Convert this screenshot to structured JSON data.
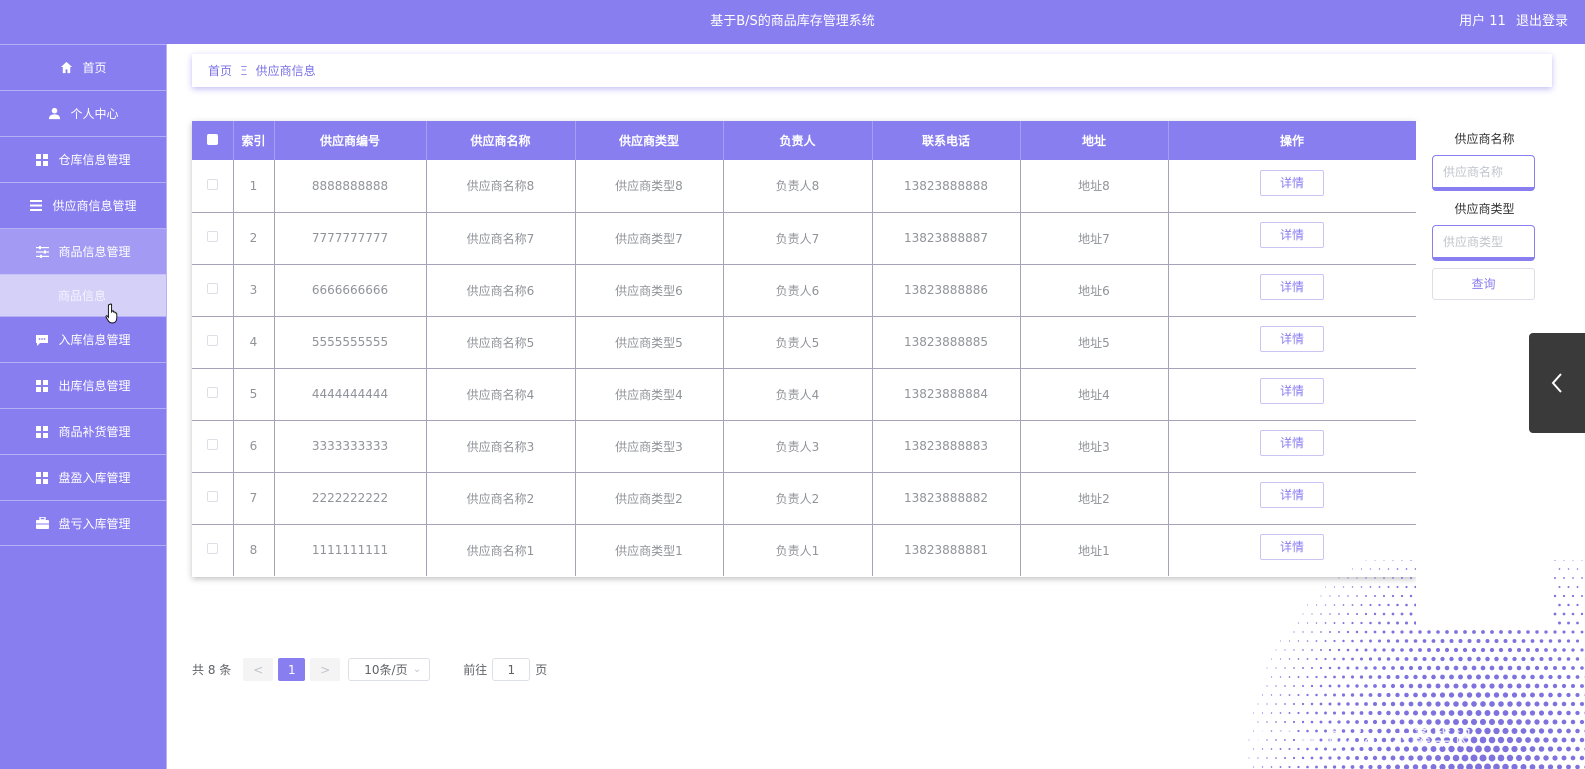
{
  "header": {
    "title": "基于B/S的商品库存管理系统",
    "user_label": "用户 11",
    "logout_label": "退出登录"
  },
  "sidebar": {
    "items": [
      {
        "label": "首页",
        "icon": "home-icon"
      },
      {
        "label": "个人中心",
        "icon": "user-icon"
      },
      {
        "label": "仓库信息管理",
        "icon": "grid-icon"
      },
      {
        "label": "供应商信息管理",
        "icon": "list-icon"
      },
      {
        "label": "商品信息管理",
        "icon": "sliders-icon"
      },
      {
        "label": "入库信息管理",
        "icon": "chat-icon"
      },
      {
        "label": "出库信息管理",
        "icon": "grid-icon"
      },
      {
        "label": "商品补货管理",
        "icon": "grid-icon"
      },
      {
        "label": "盘盈入库管理",
        "icon": "grid-icon"
      },
      {
        "label": "盘亏入库管理",
        "icon": "briefcase-icon"
      }
    ],
    "subitem": {
      "label": "商品信息"
    }
  },
  "breadcrumb": {
    "home": "首页",
    "separator": "Ξ",
    "current": "供应商信息"
  },
  "table": {
    "columns": [
      "索引",
      "供应商编号",
      "供应商名称",
      "供应商类型",
      "负责人",
      "联系电话",
      "地址",
      "操作"
    ],
    "detail_label": "详情",
    "rows": [
      {
        "index": "1",
        "code": "8888888888",
        "name": "供应商名称8",
        "type": "供应商类型8",
        "person": "负责人8",
        "phone": "13823888888",
        "address": "地址8"
      },
      {
        "index": "2",
        "code": "7777777777",
        "name": "供应商名称7",
        "type": "供应商类型7",
        "person": "负责人7",
        "phone": "13823888887",
        "address": "地址7"
      },
      {
        "index": "3",
        "code": "6666666666",
        "name": "供应商名称6",
        "type": "供应商类型6",
        "person": "负责人6",
        "phone": "13823888886",
        "address": "地址6"
      },
      {
        "index": "4",
        "code": "5555555555",
        "name": "供应商名称5",
        "type": "供应商类型5",
        "person": "负责人5",
        "phone": "13823888885",
        "address": "地址5"
      },
      {
        "index": "5",
        "code": "4444444444",
        "name": "供应商名称4",
        "type": "供应商类型4",
        "person": "负责人4",
        "phone": "13823888884",
        "address": "地址4"
      },
      {
        "index": "6",
        "code": "3333333333",
        "name": "供应商名称3",
        "type": "供应商类型3",
        "person": "负责人3",
        "phone": "13823888883",
        "address": "地址3"
      },
      {
        "index": "7",
        "code": "2222222222",
        "name": "供应商名称2",
        "type": "供应商类型2",
        "person": "负责人2",
        "phone": "13823888882",
        "address": "地址2"
      },
      {
        "index": "8",
        "code": "1111111111",
        "name": "供应商名称1",
        "type": "供应商类型1",
        "person": "负责人1",
        "phone": "13823888881",
        "address": "地址1"
      }
    ]
  },
  "search": {
    "name_label": "供应商名称",
    "name_placeholder": "供应商名称",
    "type_label": "供应商类型",
    "type_placeholder": "供应商类型",
    "query_label": "查询"
  },
  "pager": {
    "total": "共 8 条",
    "prev": "<",
    "current": "1",
    "next": ">",
    "page_size": "10条/页",
    "goto_label": "前往",
    "goto_value": "1",
    "page_suffix": "页"
  },
  "watermark": "CSDN @xiao木桑毕设",
  "colors": {
    "accent": "#887ef0",
    "accent_light": "#a29af3",
    "submenu_bg": "#d4d0f7"
  }
}
